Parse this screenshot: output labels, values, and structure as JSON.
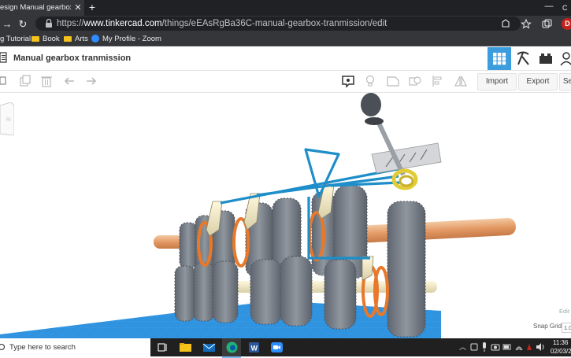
{
  "browser": {
    "tab": {
      "title": "esign Manual gearbox transmission",
      "close_glyph": "✕"
    },
    "new_tab_glyph": "+",
    "window_min_glyph": "—",
    "window_extra_glyph": "C",
    "address": {
      "url_prefix": "https://",
      "url_host": "www.tinkercad.com",
      "url_path": "/things/eEAsRgBa36C-manual-gearbox-tranmission/edit"
    },
    "nav": {
      "back": "→",
      "reload": "↻"
    },
    "toolbar_icons": [
      "read-aloud-icon",
      "favorite-icon",
      "collections-icon"
    ],
    "profile_letter": "D",
    "bookmarks": [
      {
        "label": "g Tutorial",
        "icon": "none"
      },
      {
        "label": "Book",
        "icon": "folder-icon"
      },
      {
        "label": "Arts",
        "icon": "folder-icon"
      },
      {
        "label": "My Profile - Zoom",
        "icon": "zoom-icon"
      }
    ]
  },
  "tinkercad": {
    "design_title": "Manual gearbox tranmission",
    "accent_color": "#3b9ddd",
    "header_buttons": [
      "3d-design-icon",
      "circuits-pickaxe-icon",
      "codeblocks-bricks-icon",
      "user-icon"
    ],
    "toolbar": {
      "left_tools": [
        "copy-icon",
        "duplicate-icon",
        "delete-icon",
        "undo-icon",
        "redo-icon"
      ],
      "right_tools": [
        "notes-icon",
        "light-bulb-icon",
        "shape-icon",
        "group-icon",
        "align-icon",
        "mirror-icon"
      ],
      "import_label": "Import",
      "export_label": "Export",
      "send_label": "Se"
    },
    "canvas": {
      "edit_grid_label": "Edit",
      "snap_grid_label": "Snap Grid",
      "snap_grid_value": "1.0"
    }
  },
  "taskbar": {
    "search_placeholder": "Type here to search",
    "pinned": [
      "task-view-icon",
      "file-explorer-icon",
      "mail-icon",
      "edge-icon",
      "word-icon",
      "zoom-icon"
    ],
    "time": "11:36",
    "date": "02/03/20"
  }
}
